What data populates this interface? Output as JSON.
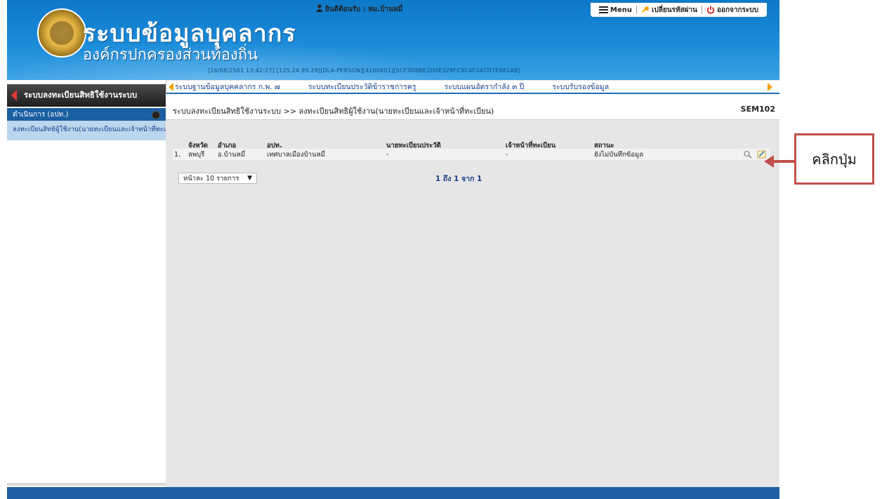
{
  "header": {
    "title": "ระบบข้อมูลบุคลากร",
    "subtitle": "องค์กรปกครองส่วนท้องถิ่น",
    "session_info": "[16/08/2561 13:42:27] [125.24.99.29][DLA-PERSON][4160601][5CF3D8BE2D0E328FC9C4F24CD7E981AB]",
    "welcome": "ยินดีต้อนรับ : หม.บ้านหมี่",
    "menu_label": "Menu",
    "change_password_label": "เปลี่ยนรหัสผ่าน",
    "logout_label": "ออกจากระบบ"
  },
  "menubar": {
    "items": [
      "ระบบฐานข้อมูลบุคคลากร ก.พ. ๗",
      "ระบบทะเบียนประวัติข้าราชการครู",
      "ระบบแผนอัตรากำลัง ๓ ปี",
      "ระบบรับรองข้อมูล"
    ]
  },
  "sidebar": {
    "heading": "ระบบลงทะเบียนสิทธิใช้งานระบบ",
    "section": "ดำเนินการ (อปท.)",
    "item": "ลงทะเบียนสิทธิผู้ใช้งาน(นายทะเบียนและเจ้าหน้าที่ทะเบียน)"
  },
  "main": {
    "breadcrumb": "ระบบลงทะเบียนสิทธิใช้งานระบบ >> ลงทะเบียนสิทธิผู้ใช้งาน(นายทะเบียนและเจ้าหน้าที่ทะเบียน)",
    "screen_code": "SEM102",
    "columns": [
      "จังหวัด",
      "อำเภอ",
      "อปท.",
      "นายทะเบียนประวัติ",
      "เจ้าหน้าที่ทะเบียน",
      "สถานะ"
    ],
    "rows": [
      {
        "no": "1.",
        "province": "ลพบุรี",
        "district": "อ.บ้านหมี่",
        "org": "เทศบาลเมืองบ้านหมี่",
        "registrar": "-",
        "officer": "-",
        "status": "ยังไม่บันทึกข้อมูล"
      }
    ],
    "page_size": "หน้าละ 10 รายการ",
    "paging_text": "1 ถึง 1 จาก 1"
  },
  "callout": {
    "text": "คลิกปุ่ม",
    "color": "#c0504d"
  },
  "colors": {
    "header_blue": "#1b8bd8",
    "menu_accent": "#f0a500",
    "sidebar_section": "#1a5fa0",
    "sidebar_item": "#bcd6ee"
  }
}
